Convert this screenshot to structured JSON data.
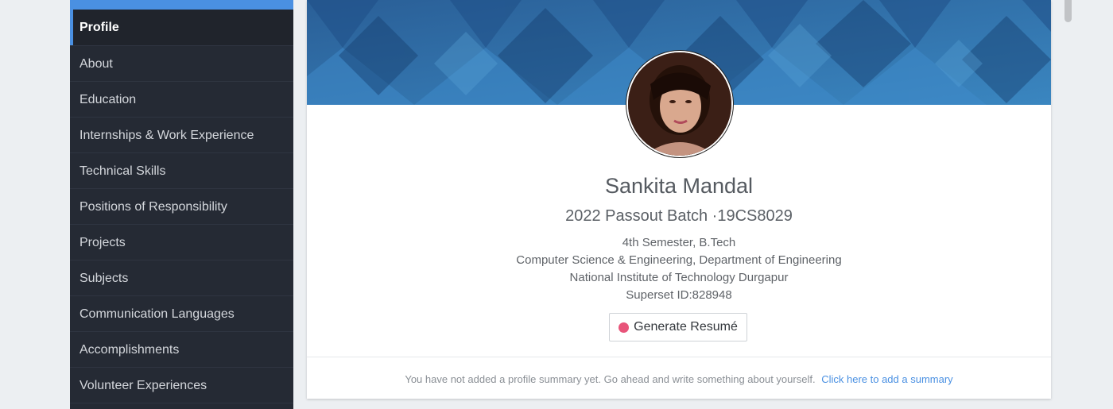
{
  "sidebar": {
    "items": [
      {
        "label": "Profile",
        "active": true
      },
      {
        "label": "About"
      },
      {
        "label": "Education"
      },
      {
        "label": "Internships & Work Experience"
      },
      {
        "label": "Technical Skills"
      },
      {
        "label": "Positions of Responsibility"
      },
      {
        "label": "Projects"
      },
      {
        "label": "Subjects"
      },
      {
        "label": "Communication Languages"
      },
      {
        "label": "Accomplishments"
      },
      {
        "label": "Volunteer Experiences"
      }
    ]
  },
  "profile": {
    "name": "Sankita Mandal",
    "batch": "2022 Passout Batch ·19CS8029",
    "semester": "4th Semester, B.Tech",
    "department": "Computer Science & Engineering, Department of Engineering",
    "institute": "National Institute of Technology Durgapur",
    "superset_id": "Superset ID:828948",
    "resume_button": "Generate Resumé"
  },
  "summary": {
    "text": "You have not added a profile summary yet. Go ahead and write something about yourself.",
    "link": "Click here to add a summary"
  },
  "colors": {
    "accent": "#4a90e2",
    "sidebar_bg": "#252a34",
    "resume_dot": "#e8547a"
  }
}
